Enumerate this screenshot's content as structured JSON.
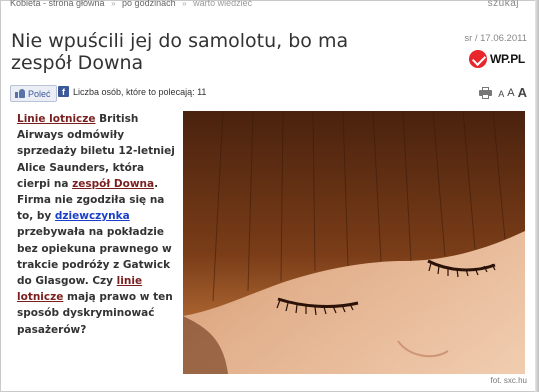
{
  "topbar": {
    "crumbs": [
      "Kobieta - strona główna",
      "po godzinach",
      "warto wiedzieć"
    ],
    "search_label": "szukaj"
  },
  "article": {
    "title": "Nie wpuścili jej do samolotu, bo ma zespół Downa",
    "byline": "sr / 17.06.2011",
    "source_logo": "WP.PL"
  },
  "social": {
    "like_label": "Poleć",
    "count_text": "Liczba osób, które to polecają: 11"
  },
  "tools": {
    "font_small": "A",
    "font_medium": "A",
    "font_large": "A"
  },
  "body": {
    "lead_link": "Linie lotnicze",
    "t1": " British Airways odmówiły sprzedaży biletu 12-letniej Alice Saunders, która cierpi na ",
    "link_down": "zespół Downa",
    "t2": ". Firma nie zgodziła się na to, by ",
    "link_girl": "dziewczynka",
    "t3": " przebywała na pokładzie bez opiekuna prawnego w trakcie podróży z Gatwick do Glasgow. Czy ",
    "link_airlines": "linie lotnicze",
    "t4": " mają prawo w ten sposób dyskryminować pasażerów?"
  },
  "photo": {
    "credit": "fot. sxc.hu"
  },
  "colors": {
    "link_red": "#7a1f1f",
    "link_blue": "#1a3fc8",
    "brand_red": "#e8262b",
    "fb_blue": "#3b5998"
  }
}
